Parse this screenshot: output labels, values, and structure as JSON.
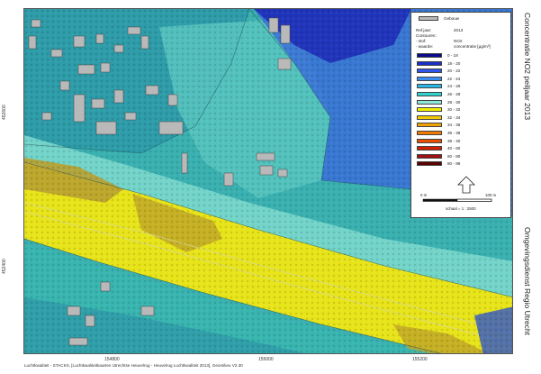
{
  "map": {
    "y_ticks": [
      "452600",
      "452400"
    ],
    "x_ticks": [
      "154800",
      "155000",
      "155200"
    ]
  },
  "footer": "Luchtkwaliteit - STACKS, [Luchtkwaliteitkaarten Utrechtse Heuvelrug - Heuvelrug Luchtkwaliteit 2013], Geomilieu V2.30",
  "side_title": "Concentratie NO2 peiljaar 2013",
  "organisation": "Omgevingsdienst Regio Utrecht",
  "legend": {
    "building_label": "Gebouw",
    "info": [
      {
        "key": "Ref.jaar:",
        "value": "2013"
      },
      {
        "key": "Contouren:",
        "value": ""
      },
      {
        "key": "- stof:",
        "value": "NO2"
      },
      {
        "key": "- waarde:",
        "value": "concentratie [µg/m³]"
      }
    ],
    "classes": [
      {
        "label": "0 - 18",
        "color": "#0a0a8a"
      },
      {
        "label": "18 - 20",
        "color": "#1a2fc8"
      },
      {
        "label": "20 - 22",
        "color": "#2e55e8"
      },
      {
        "label": "22 - 24",
        "color": "#3a8cf0"
      },
      {
        "label": "24 - 26",
        "color": "#2ab8e8"
      },
      {
        "label": "26 - 28",
        "color": "#2ed4d0"
      },
      {
        "label": "28 - 30",
        "color": "#8ce8d8"
      },
      {
        "label": "30 - 32",
        "color": "#f2f000"
      },
      {
        "label": "32 - 34",
        "color": "#f2c800"
      },
      {
        "label": "34 - 36",
        "color": "#f0a000"
      },
      {
        "label": "36 - 38",
        "color": "#f07a00"
      },
      {
        "label": "38 - 40",
        "color": "#e85000"
      },
      {
        "label": "40 - 60",
        "color": "#d02000"
      },
      {
        "label": "60 - 80",
        "color": "#a01010"
      },
      {
        "label": "80 - 99",
        "color": "#5a0000"
      }
    ],
    "scale_start": "0 m",
    "scale_end": "100 m",
    "scale_text": "schaal = 1 : 2500"
  }
}
